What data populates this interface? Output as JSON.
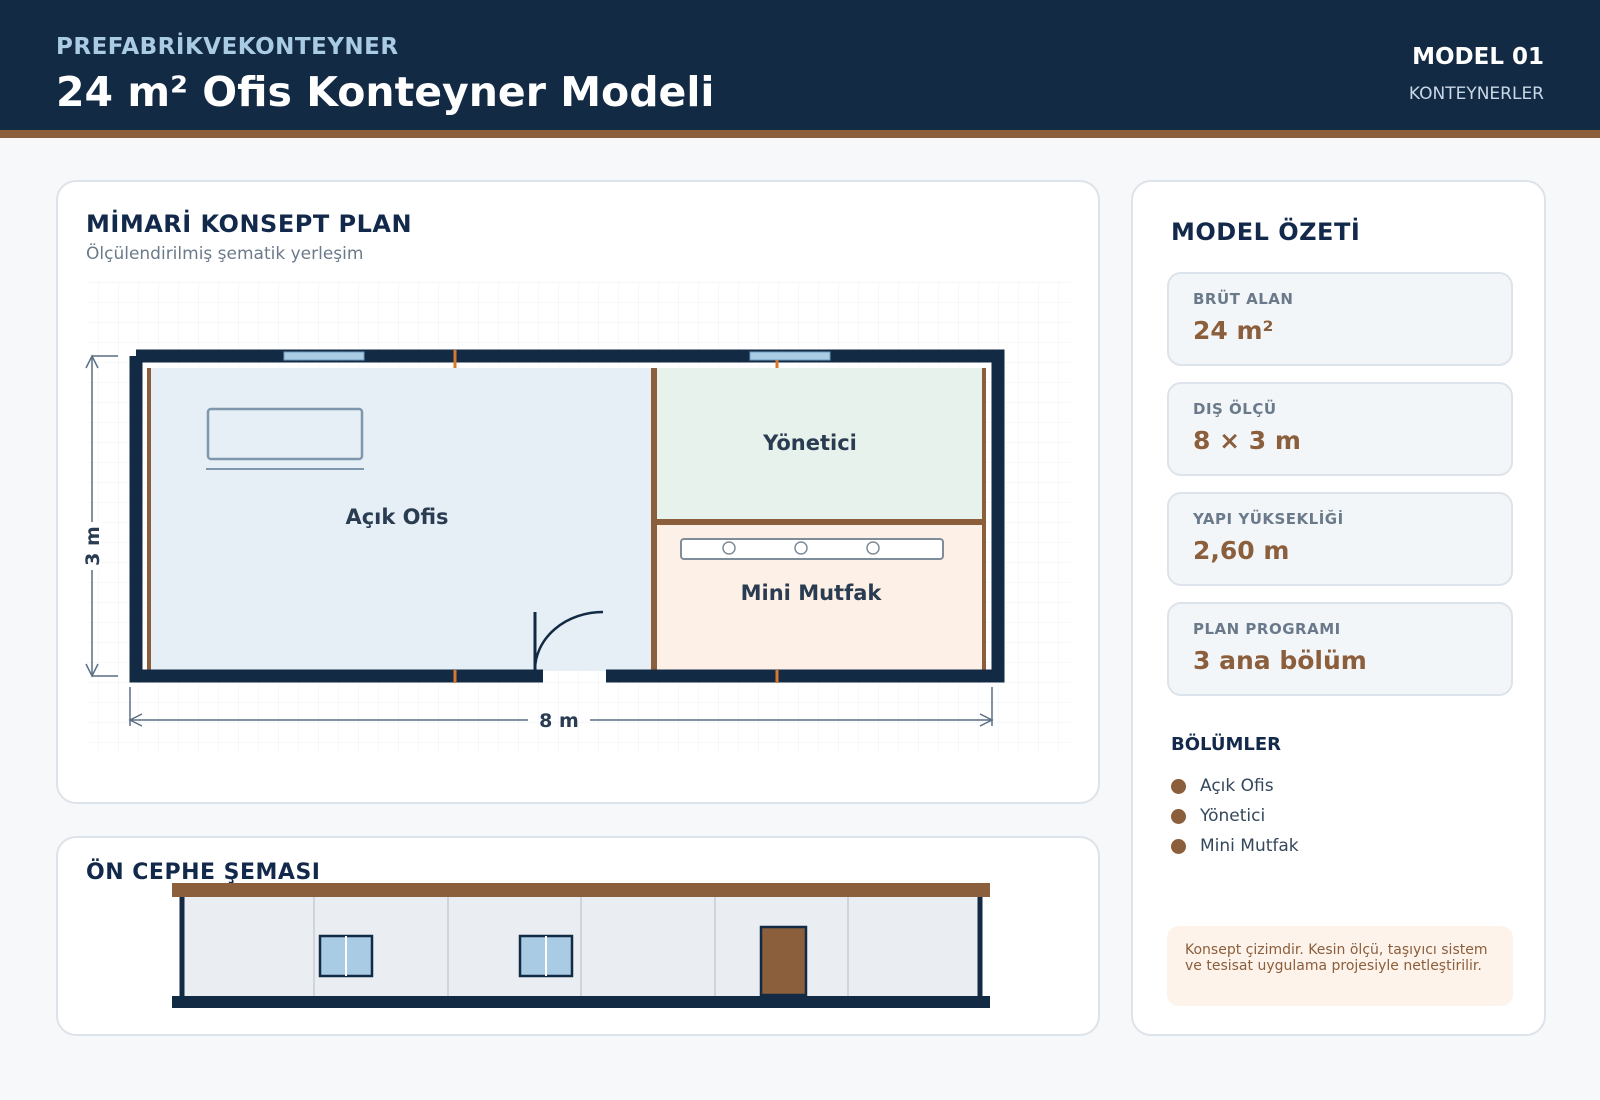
{
  "header": {
    "brand": "PREFABRİKVEKONTEYNER",
    "title": "24 m² Ofis Konteyner Modeli",
    "model": "MODEL 01",
    "category": "KONTEYNERLER"
  },
  "plan": {
    "title": "MİMARİ KONSEPT PLAN",
    "subtitle": "Ölçülendirilmiş şematik yerleşim",
    "rooms": {
      "open_office": "Açık Ofis",
      "manager": "Yönetici",
      "kitchen": "Mini Mutfak"
    },
    "dim_width": "8 m",
    "dim_height": "3 m"
  },
  "facade": {
    "title": "ÖN CEPHE ŞEMASI"
  },
  "summary": {
    "title": "MODEL ÖZETİ",
    "stats": [
      {
        "label": "BRÜT ALAN",
        "value": "24 m²"
      },
      {
        "label": "DIŞ ÖLÇÜ",
        "value": "8 × 3 m"
      },
      {
        "label": "YAPI YÜKSEKLİĞİ",
        "value": "2,60 m"
      },
      {
        "label": "PLAN PROGRAMI",
        "value": "3 ana bölüm"
      }
    ],
    "sections_title": "BÖLÜMLER",
    "sections": [
      "Açık Ofis",
      "Yönetici",
      "Mini Mutfak"
    ],
    "note": "Konsept çizimdir. Kesin ölçü, taşıyıcı sistem ve tesisat uygulama projesiyle netleştirilir."
  },
  "colors": {
    "navy": "#132a45",
    "brown": "#8b5e3c",
    "open_office_fill": "#e6eff5",
    "manager_fill": "#e8f2ec",
    "kitchen_fill": "#fdf0e6"
  }
}
